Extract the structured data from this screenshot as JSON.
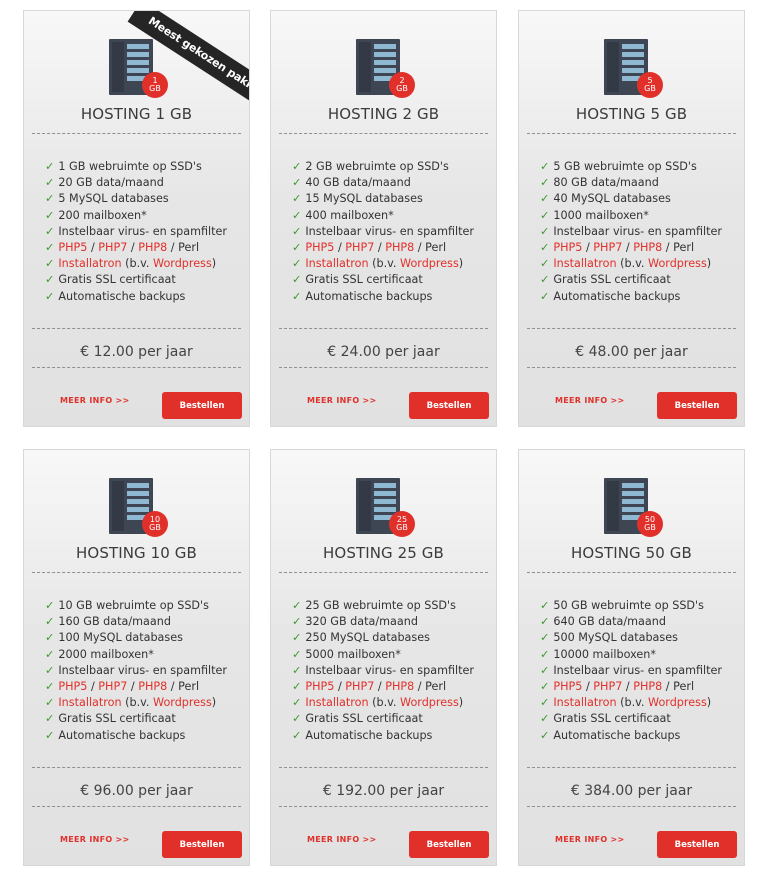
{
  "ribbon_label": "Meest gekozen pakket",
  "separator": "/",
  "colors": {
    "accent": "#e1302a",
    "check": "#3a9a2a",
    "card_bg": "#e6e6e6"
  },
  "plans": [
    {
      "badge": "1 GB",
      "title": "HOSTING 1 GB",
      "features": [
        "1 GB webruimte op SSD's",
        "20 GB data/maand",
        "5 MySQL databases",
        "200 mailboxen*",
        "Instelbaar virus- en spamfilter"
      ],
      "php": [
        "PHP5",
        "PHP7",
        "PHP8"
      ],
      "perl": "Perl",
      "installatron": "Installatron",
      "bv": " (b.v. ",
      "wordpress": "Wordpress",
      "close": ")",
      "ssl": "Gratis SSL certificaat",
      "backups": "Automatische backups",
      "price": "€ 12.00 per jaar",
      "more": "MEER INFO >>",
      "order": "Bestellen"
    },
    {
      "badge": "2 GB",
      "title": "HOSTING 2 GB",
      "features": [
        "2 GB webruimte op SSD's",
        "40 GB data/maand",
        "15 MySQL databases",
        "400 mailboxen*",
        "Instelbaar virus- en spamfilter"
      ],
      "php": [
        "PHP5",
        "PHP7",
        "PHP8"
      ],
      "perl": "Perl",
      "installatron": "Installatron",
      "bv": " (b.v. ",
      "wordpress": "Wordpress",
      "close": ")",
      "ssl": "Gratis SSL certificaat",
      "backups": "Automatische backups",
      "price": "€ 24.00 per jaar",
      "more": "MEER INFO >>",
      "order": "Bestellen"
    },
    {
      "badge": "5 GB",
      "title": "HOSTING 5 GB",
      "features": [
        "5 GB webruimte op SSD's",
        "80 GB data/maand",
        "40 MySQL databases",
        "1000 mailboxen*",
        "Instelbaar virus- en spamfilter"
      ],
      "php": [
        "PHP5",
        "PHP7",
        "PHP8"
      ],
      "perl": "Perl",
      "installatron": "Installatron",
      "bv": " (b.v. ",
      "wordpress": "Wordpress",
      "close": ")",
      "ssl": "Gratis SSL certificaat",
      "backups": "Automatische backups",
      "price": "€ 48.00 per jaar",
      "more": "MEER INFO >>",
      "order": "Bestellen"
    },
    {
      "badge": "10 GB",
      "title": "HOSTING 10 GB",
      "features": [
        "10 GB webruimte op SSD's",
        "160 GB data/maand",
        "100 MySQL databases",
        "2000 mailboxen*",
        "Instelbaar virus- en spamfilter"
      ],
      "php": [
        "PHP5",
        "PHP7",
        "PHP8"
      ],
      "perl": "Perl",
      "installatron": "Installatron",
      "bv": " (b.v. ",
      "wordpress": "Wordpress",
      "close": ")",
      "ssl": "Gratis SSL certificaat",
      "backups": "Automatische backups",
      "price": "€ 96.00 per jaar",
      "more": "MEER INFO >>",
      "order": "Bestellen"
    },
    {
      "badge": "25 GB",
      "title": "HOSTING 25 GB",
      "features": [
        "25 GB webruimte op SSD's",
        "320 GB data/maand",
        "250 MySQL databases",
        "5000 mailboxen*",
        "Instelbaar virus- en spamfilter"
      ],
      "php": [
        "PHP5",
        "PHP7",
        "PHP8"
      ],
      "perl": "Perl",
      "installatron": "Installatron",
      "bv": " (b.v. ",
      "wordpress": "Wordpress",
      "close": ")",
      "ssl": "Gratis SSL certificaat",
      "backups": "Automatische backups",
      "price": "€ 192.00 per jaar",
      "more": "MEER INFO >>",
      "order": "Bestellen"
    },
    {
      "badge": "50 GB",
      "title": "HOSTING 50 GB",
      "features": [
        "50 GB webruimte op SSD's",
        "640 GB data/maand",
        "500 MySQL databases",
        "10000 mailboxen*",
        "Instelbaar virus- en spamfilter"
      ],
      "php": [
        "PHP5",
        "PHP7",
        "PHP8"
      ],
      "perl": "Perl",
      "installatron": "Installatron",
      "bv": " (b.v. ",
      "wordpress": "Wordpress",
      "close": ")",
      "ssl": "Gratis SSL certificaat",
      "backups": "Automatische backups",
      "price": "€ 384.00 per jaar",
      "more": "MEER INFO >>",
      "order": "Bestellen"
    }
  ]
}
